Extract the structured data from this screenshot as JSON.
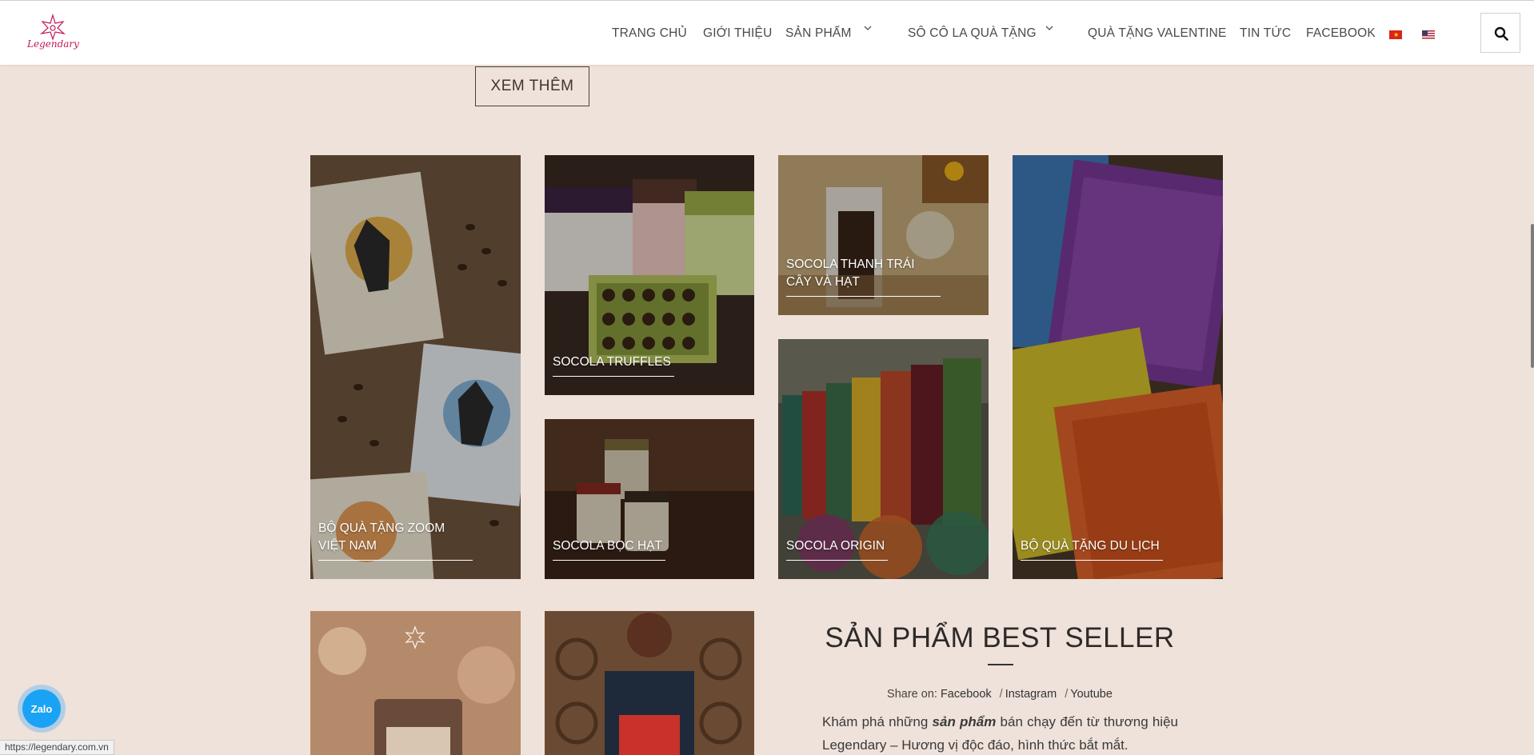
{
  "header": {
    "logo_text": "Legendary",
    "nav": [
      {
        "label": "TRANG CHỦ"
      },
      {
        "label": "GIỚI THIỆU"
      },
      {
        "label": "SẢN PHẨM"
      },
      {
        "label": "SÔ CÔ LA QUÀ TẶNG"
      },
      {
        "label": "QUÀ TẶNG VALENTINE"
      },
      {
        "label": "TIN TỨC"
      },
      {
        "label": "FACEBOOK"
      }
    ],
    "languages": [
      "vietnamese-flag-icon",
      "us-flag-icon"
    ],
    "search_icon": "search-icon"
  },
  "see_more": "XEM THÊM",
  "tiles": [
    {
      "caption": "BỘ QUÀ TẶNG ZOOM VIỆT NAM"
    },
    {
      "caption": "SOCOLA TRUFFLES"
    },
    {
      "caption": "SOCOLA THANH TRÁI CÂY VÀ HẠT"
    },
    {
      "caption": "SOCOLA BỌC HẠT"
    },
    {
      "caption": "SOCOLA ORIGIN"
    },
    {
      "caption": "BỘ QUÀ TẶNG DU LỊCH"
    }
  ],
  "best_seller": {
    "title": "SẢN PHẨM BEST SELLER",
    "share_label": "Share on:",
    "share_links": [
      "Facebook",
      "Instagram",
      "Youtube"
    ],
    "desc_before": "Khám phá những ",
    "desc_emphasis": "sản phẩm",
    "desc_after": " bán chạy đến từ thương hiệu Legendary – Hương vị độc đáo, hình thức bắt mắt."
  },
  "zalo_label": "Zalo",
  "status_url": "https://legendary.com.vn",
  "colors": {
    "page_bg": "#efe2db",
    "header_bg": "#ffffff",
    "logo_pink": "#c2185b",
    "zalo_blue": "#1aa3f5"
  }
}
